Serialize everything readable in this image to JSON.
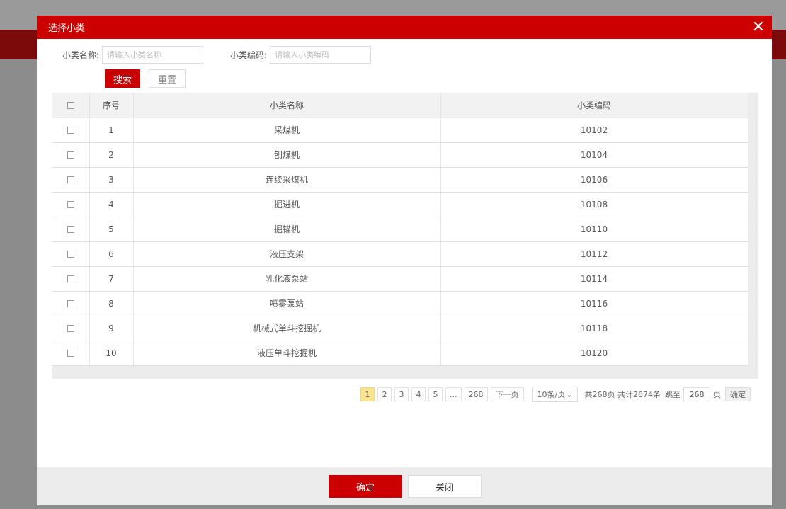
{
  "modal": {
    "title": "选择小类",
    "close_icon": "close-icon"
  },
  "filters": {
    "name_label": "小类名称:",
    "name_placeholder": "请输入小类名称",
    "code_label": "小类编码:",
    "code_placeholder": "请输入小类编码",
    "search_label": "搜索",
    "reset_label": "重置"
  },
  "table": {
    "headers": [
      "",
      "序号",
      "小类名称",
      "小类编码"
    ],
    "rows": [
      {
        "no": "1",
        "name": "采煤机",
        "code": "10102"
      },
      {
        "no": "2",
        "name": "刨煤机",
        "code": "10104"
      },
      {
        "no": "3",
        "name": "连续采煤机",
        "code": "10106"
      },
      {
        "no": "4",
        "name": "掘进机",
        "code": "10108"
      },
      {
        "no": "5",
        "name": "掘锚机",
        "code": "10110"
      },
      {
        "no": "6",
        "name": "液压支架",
        "code": "10112"
      },
      {
        "no": "7",
        "name": "乳化液泵站",
        "code": "10114"
      },
      {
        "no": "8",
        "name": "喷雾泵站",
        "code": "10116"
      },
      {
        "no": "9",
        "name": "机械式单斗挖掘机",
        "code": "10118"
      },
      {
        "no": "10",
        "name": "液压单斗挖掘机",
        "code": "10120"
      }
    ]
  },
  "pagination": {
    "pages": [
      "1",
      "2",
      "3",
      "4",
      "5",
      "...",
      "268"
    ],
    "current": "1",
    "next_label": "下一页",
    "page_size": "10条/页",
    "total_text": "共268页 共计2674条",
    "jump_label": "跳至",
    "jump_value": "268",
    "page_unit": "页",
    "confirm_label": "确定"
  },
  "footer": {
    "ok_label": "确定",
    "close_label": "关闭"
  },
  "colors": {
    "accent": "#cc0000",
    "active_page": "#fce390"
  }
}
